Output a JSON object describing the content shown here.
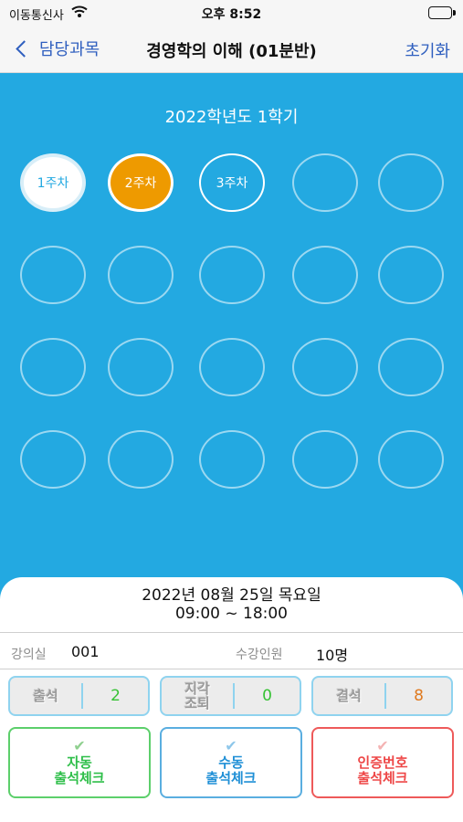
{
  "status_bar": {
    "carrier": "이동통신사",
    "time": "오후 8:52",
    "wifi_icon": "wifi-icon",
    "battery_icon": "battery-icon"
  },
  "nav": {
    "back_label": "담당과목",
    "back_icon": "chevron-left-icon",
    "title": "경영학의 이해 (01분반)",
    "reset_label": "초기화"
  },
  "semester": "2022학년도 1학기",
  "weeks": [
    {
      "label": "1주차",
      "state": "done"
    },
    {
      "label": "2주차",
      "state": "active"
    },
    {
      "label": "3주차",
      "state": "open"
    },
    {
      "label": "",
      "state": "empty"
    },
    {
      "label": "",
      "state": "empty"
    },
    {
      "label": "",
      "state": "empty"
    },
    {
      "label": "",
      "state": "empty"
    },
    {
      "label": "",
      "state": "empty"
    },
    {
      "label": "",
      "state": "empty"
    },
    {
      "label": "",
      "state": "empty"
    },
    {
      "label": "",
      "state": "empty"
    },
    {
      "label": "",
      "state": "empty"
    },
    {
      "label": "",
      "state": "empty"
    },
    {
      "label": "",
      "state": "empty"
    },
    {
      "label": "",
      "state": "empty"
    },
    {
      "label": "",
      "state": "empty"
    },
    {
      "label": "",
      "state": "empty"
    },
    {
      "label": "",
      "state": "empty"
    },
    {
      "label": "",
      "state": "empty"
    },
    {
      "label": "",
      "state": "empty"
    }
  ],
  "session": {
    "date": "2022년 08월 25일 목요일",
    "time_range": "09:00 ~ 18:00"
  },
  "info": {
    "room_label": "강의실",
    "room_value": "001",
    "enrolled_label": "수강인원",
    "enrolled_value": "10명"
  },
  "stats": {
    "attend_label": "출석",
    "attend_value": "2",
    "late_label_1": "지각",
    "late_label_2": "조퇴",
    "late_value": "0",
    "absent_label": "결석",
    "absent_value": "8"
  },
  "actions": {
    "auto_line1": "자동",
    "auto_line2": "출석체크",
    "manual_line1": "수동",
    "manual_line2": "출석체크",
    "code_line1": "인증번호",
    "code_line2": "출석체크",
    "check_icon": "checkmark-icon"
  },
  "colors": {
    "main_bg": "#23a9e1",
    "active_week": "#ee9a00",
    "nav_accent": "#2f5fbf",
    "attend": "#36c234",
    "late": "#36c234",
    "absent": "#e07a1f",
    "auto": "#2fbf4a",
    "manual": "#1f8fd6",
    "code": "#ee4747"
  }
}
